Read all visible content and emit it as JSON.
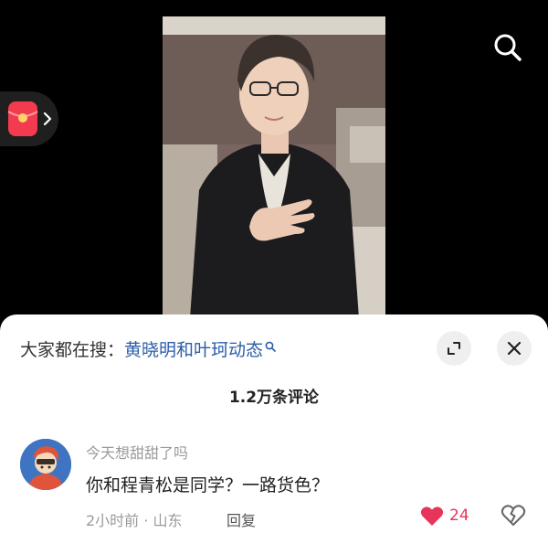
{
  "colors": {
    "accent_link": "#2b5da8",
    "like_red": "#e8345a",
    "sheet_bg": "#ffffff",
    "background": "#000000"
  },
  "video": {
    "icons": {
      "search": "search-icon",
      "red_packet": "red-packet-icon",
      "chevron": "chevron-right-icon"
    }
  },
  "comments_panel": {
    "suggest_prefix": "大家都在搜：",
    "suggest_topic": "黄晓明和叶珂动态",
    "comment_count": "1.2万条评论",
    "icons": {
      "expand": "expand-icon",
      "close": "close-icon"
    }
  },
  "comment": {
    "username": "今天想甜甜了吗",
    "text": "你和程青松是同学？一路货色？",
    "meta": "2小时前 · 山东",
    "reply_label": "回复",
    "like_count": "24",
    "icons": {
      "like": "heart-icon",
      "dislike": "broken-heart-icon"
    }
  }
}
